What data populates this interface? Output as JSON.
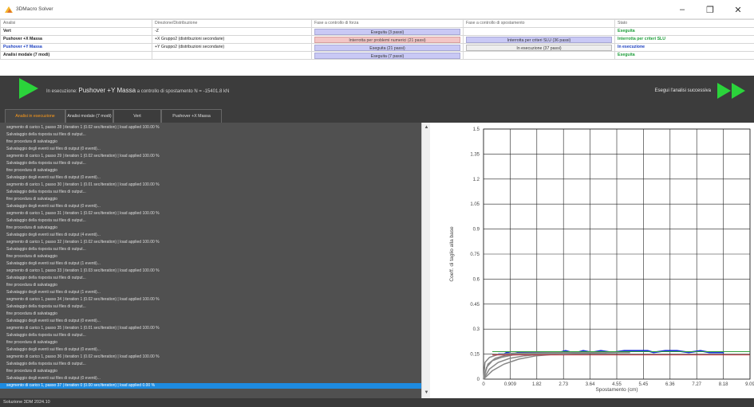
{
  "window": {
    "title": "3DMacro Solver",
    "minimize": "–",
    "restore": "❐",
    "close": "✕"
  },
  "table": {
    "headers": [
      "Analisi",
      "Direzione/Distribuzione",
      "Fase a controllo di forza",
      "Fase a controllo di spostamento",
      "Stato"
    ],
    "rows": [
      {
        "name": "Vert",
        "direction": "-Z",
        "force": "Eseguita (3 passi)",
        "force_style": "blue",
        "disp": "",
        "disp_style": "none",
        "status": "Eseguita",
        "status_style": "green",
        "name_style": "bold"
      },
      {
        "name": "Pushover +X Massa",
        "direction": "+X Gruppo2 (distribuzioni secondarie)",
        "force": "Interrotta per problemi numerici (21 passi)",
        "force_style": "red",
        "disp": "Interrotta per criteri SLU (36 passi)",
        "disp_style": "blue",
        "status": "Interrotta per criteri SLU",
        "status_style": "green",
        "name_style": "bold"
      },
      {
        "name": "Pushover +Y Massa",
        "direction": "+Y Gruppo2 (distribuzioni secondarie)",
        "force": "Eseguita (21 passi)",
        "force_style": "blue",
        "disp": "In esecuzione (37 passi)",
        "disp_style": "light",
        "status": "In esecuzione",
        "status_style": "blue",
        "name_style": "blue"
      },
      {
        "name": "Analisi modale (7 modi)",
        "direction": "",
        "force": "Eseguita (7 passi)",
        "force_style": "blue",
        "disp": "",
        "disp_style": "none",
        "status": "Eseguita",
        "status_style": "green",
        "name_style": "bold"
      }
    ]
  },
  "run": {
    "prefix": "In esecuzione:",
    "analysis": "Pushover +Y Massa",
    "detail": "a controllo di spostamento N = -15401.8 kN",
    "next_label": "Esegui l'analisi successiva"
  },
  "tabs": [
    {
      "label": "Analisi in esecuzione",
      "active": true
    },
    {
      "label": "Analisi modale (7 modi)",
      "active": false
    },
    {
      "label": "Vert",
      "active": false
    },
    {
      "label": "Pushover +X Massa",
      "active": false
    }
  ],
  "log": [
    "segmento di carico 1, passo 28 | iteration 1 (0.02 sec/iteration) | load applied 100.00 %",
    "        Salvataggio della risposta sui files di output...",
    "fine procedura di salvataggio",
    "        Salvataggio degli eventi sui files di output (0 eventi)...",
    "segmento di carico 1, passo 29 | iteration 1 (0.02 sec/iteration) | load applied 100.00 %",
    "        Salvataggio della risposta sui files di output...",
    "fine procedura di salvataggio",
    "        Salvataggio degli eventi sui files di output (0 eventi)...",
    "segmento di carico 1, passo 30 | iteration 1 (0.01 sec/iteration) | load applied 100.00 %",
    "        Salvataggio della risposta sui files di output...",
    "fine procedura di salvataggio",
    "        Salvataggio degli eventi sui files di output (0 eventi)...",
    "segmento di carico 1, passo 31 | iteration 1 (0.02 sec/iteration) | load applied 100.00 %",
    "        Salvataggio della risposta sui files di output...",
    "fine procedura di salvataggio",
    "        Salvataggio degli eventi sui files di output (4 eventi)...",
    "segmento di carico 1, passo 32 | iteration 1 (0.02 sec/iteration) | load applied 100.00 %",
    "        Salvataggio della risposta sui files di output...",
    "fine procedura di salvataggio",
    "        Salvataggio degli eventi sui files di output (1 eventi)...",
    "segmento di carico 1, passo 33 | iteration 1 (0.03 sec/iteration) | load applied 100.00 %",
    "        Salvataggio della risposta sui files di output...",
    "fine procedura di salvataggio",
    "        Salvataggio degli eventi sui files di output (1 eventi)...",
    "segmento di carico 1, passo 34 | iteration 1 (0.02 sec/iteration) | load applied 100.00 %",
    "        Salvataggio della risposta sui files di output...",
    "fine procedura di salvataggio",
    "        Salvataggio degli eventi sui files di output (0 eventi)...",
    "segmento di carico 1, passo 35 | iteration 1 (0.01 sec/iteration) | load applied 100.00 %",
    "        Salvataggio della risposta sui files di output...",
    "fine procedura di salvataggio",
    "        Salvataggio degli eventi sui files di output (0 eventi)...",
    "segmento di carico 1, passo 36 | iteration 1 (0.02 sec/iteration) | load applied 100.00 %",
    "        Salvataggio della risposta sui files di output...",
    "fine procedura di salvataggio",
    "        Salvataggio degli eventi sui files di output (0 eventi)...",
    "segmento di carico 1, passo 37 | iteration 0 (0.00 sec/iteration) | load applied 0.00 %"
  ],
  "log_selected_index": 36,
  "scroll": {
    "up": "▲",
    "down": "▼"
  },
  "chart_data": {
    "type": "line",
    "xlabel": "Spostamento (cm)",
    "ylabel": "Coeff. di taglio alla base",
    "xticks": [
      "0",
      "0.909",
      "1.82",
      "2.73",
      "3.64",
      "4.55",
      "5.45",
      "6.36",
      "7.27",
      "8.18",
      "9.09"
    ],
    "yticks": [
      "0",
      "0.15",
      "0.3",
      "0.45",
      "0.6",
      "0.75",
      "0.9",
      "1.05",
      "1.2",
      "1.35",
      "1.5"
    ],
    "xlim": [
      0,
      9.09
    ],
    "ylim": [
      0,
      1.5
    ],
    "grid": true,
    "series": [
      {
        "color": "#1a2fd6",
        "width": 2,
        "points": [
          [
            0.5,
            0.15
          ],
          [
            0.7,
            0.15
          ],
          [
            0.8,
            0.16
          ],
          [
            1.0,
            0.15
          ],
          [
            1.2,
            0.16
          ],
          [
            1.5,
            0.16
          ],
          [
            1.8,
            0.16
          ],
          [
            2.2,
            0.16
          ],
          [
            2.6,
            0.16
          ],
          [
            2.8,
            0.17
          ],
          [
            3.0,
            0.16
          ],
          [
            3.2,
            0.16
          ],
          [
            3.4,
            0.17
          ],
          [
            3.7,
            0.16
          ],
          [
            4.0,
            0.17
          ],
          [
            4.4,
            0.16
          ],
          [
            4.8,
            0.17
          ],
          [
            5.2,
            0.17
          ],
          [
            5.6,
            0.17
          ],
          [
            5.8,
            0.16
          ],
          [
            6.2,
            0.17
          ],
          [
            6.6,
            0.17
          ],
          [
            7.0,
            0.16
          ],
          [
            7.4,
            0.17
          ],
          [
            7.7,
            0.16
          ],
          [
            8.2,
            0.16
          ]
        ]
      },
      {
        "color": "#888888",
        "width": 1.5,
        "points": [
          [
            0,
            0
          ],
          [
            0.1,
            0.07
          ],
          [
            0.3,
            0.11
          ],
          [
            0.6,
            0.13
          ],
          [
            1.0,
            0.145
          ],
          [
            1.5,
            0.15
          ],
          [
            2.2,
            0.155
          ],
          [
            3.0,
            0.157
          ],
          [
            4.0,
            0.158
          ],
          [
            5.0,
            0.159
          ]
        ]
      },
      {
        "color": "#888888",
        "width": 1.5,
        "points": [
          [
            0,
            0
          ],
          [
            0.2,
            0.06
          ],
          [
            0.5,
            0.1
          ],
          [
            0.9,
            0.125
          ],
          [
            1.4,
            0.14
          ],
          [
            2.0,
            0.15
          ],
          [
            2.8,
            0.155
          ],
          [
            3.6,
            0.157
          ],
          [
            4.5,
            0.158
          ]
        ]
      },
      {
        "color": "#888888",
        "width": 1.5,
        "points": [
          [
            0,
            0
          ],
          [
            0.15,
            0.09
          ],
          [
            0.4,
            0.125
          ],
          [
            0.8,
            0.145
          ],
          [
            1.3,
            0.152
          ],
          [
            2.0,
            0.156
          ],
          [
            3.0,
            0.158
          ],
          [
            4.0,
            0.159
          ]
        ]
      },
      {
        "color": "#888888",
        "width": 1.5,
        "points": [
          [
            0,
            0
          ],
          [
            0.3,
            0.05
          ],
          [
            0.7,
            0.09
          ],
          [
            1.2,
            0.12
          ],
          [
            1.8,
            0.14
          ],
          [
            2.5,
            0.15
          ],
          [
            3.3,
            0.155
          ],
          [
            4.2,
            0.157
          ]
        ]
      },
      {
        "color": "#888888",
        "width": 1.5,
        "points": [
          [
            0,
            0
          ],
          [
            0.05,
            0.1
          ],
          [
            0.2,
            0.13
          ],
          [
            0.5,
            0.148
          ],
          [
            1.0,
            0.155
          ],
          [
            2.0,
            0.158
          ],
          [
            3.0,
            0.16
          ]
        ]
      },
      {
        "color": "#2ea03a",
        "width": 1,
        "points": [
          [
            0.3,
            0.165
          ],
          [
            9.09,
            0.165
          ]
        ]
      },
      {
        "color": "#c0303a",
        "width": 1,
        "points": [
          [
            0.3,
            0.145
          ],
          [
            9.09,
            0.145
          ]
        ]
      }
    ]
  },
  "statusbar": {
    "text": "Soluzione 3DM 2024.10"
  },
  "colors": {
    "accent_green": "#2bd43b",
    "accent_orange": "#ff9b1a",
    "selected_blue": "#1e8be0",
    "panel_dark": "#3c3c3c"
  }
}
